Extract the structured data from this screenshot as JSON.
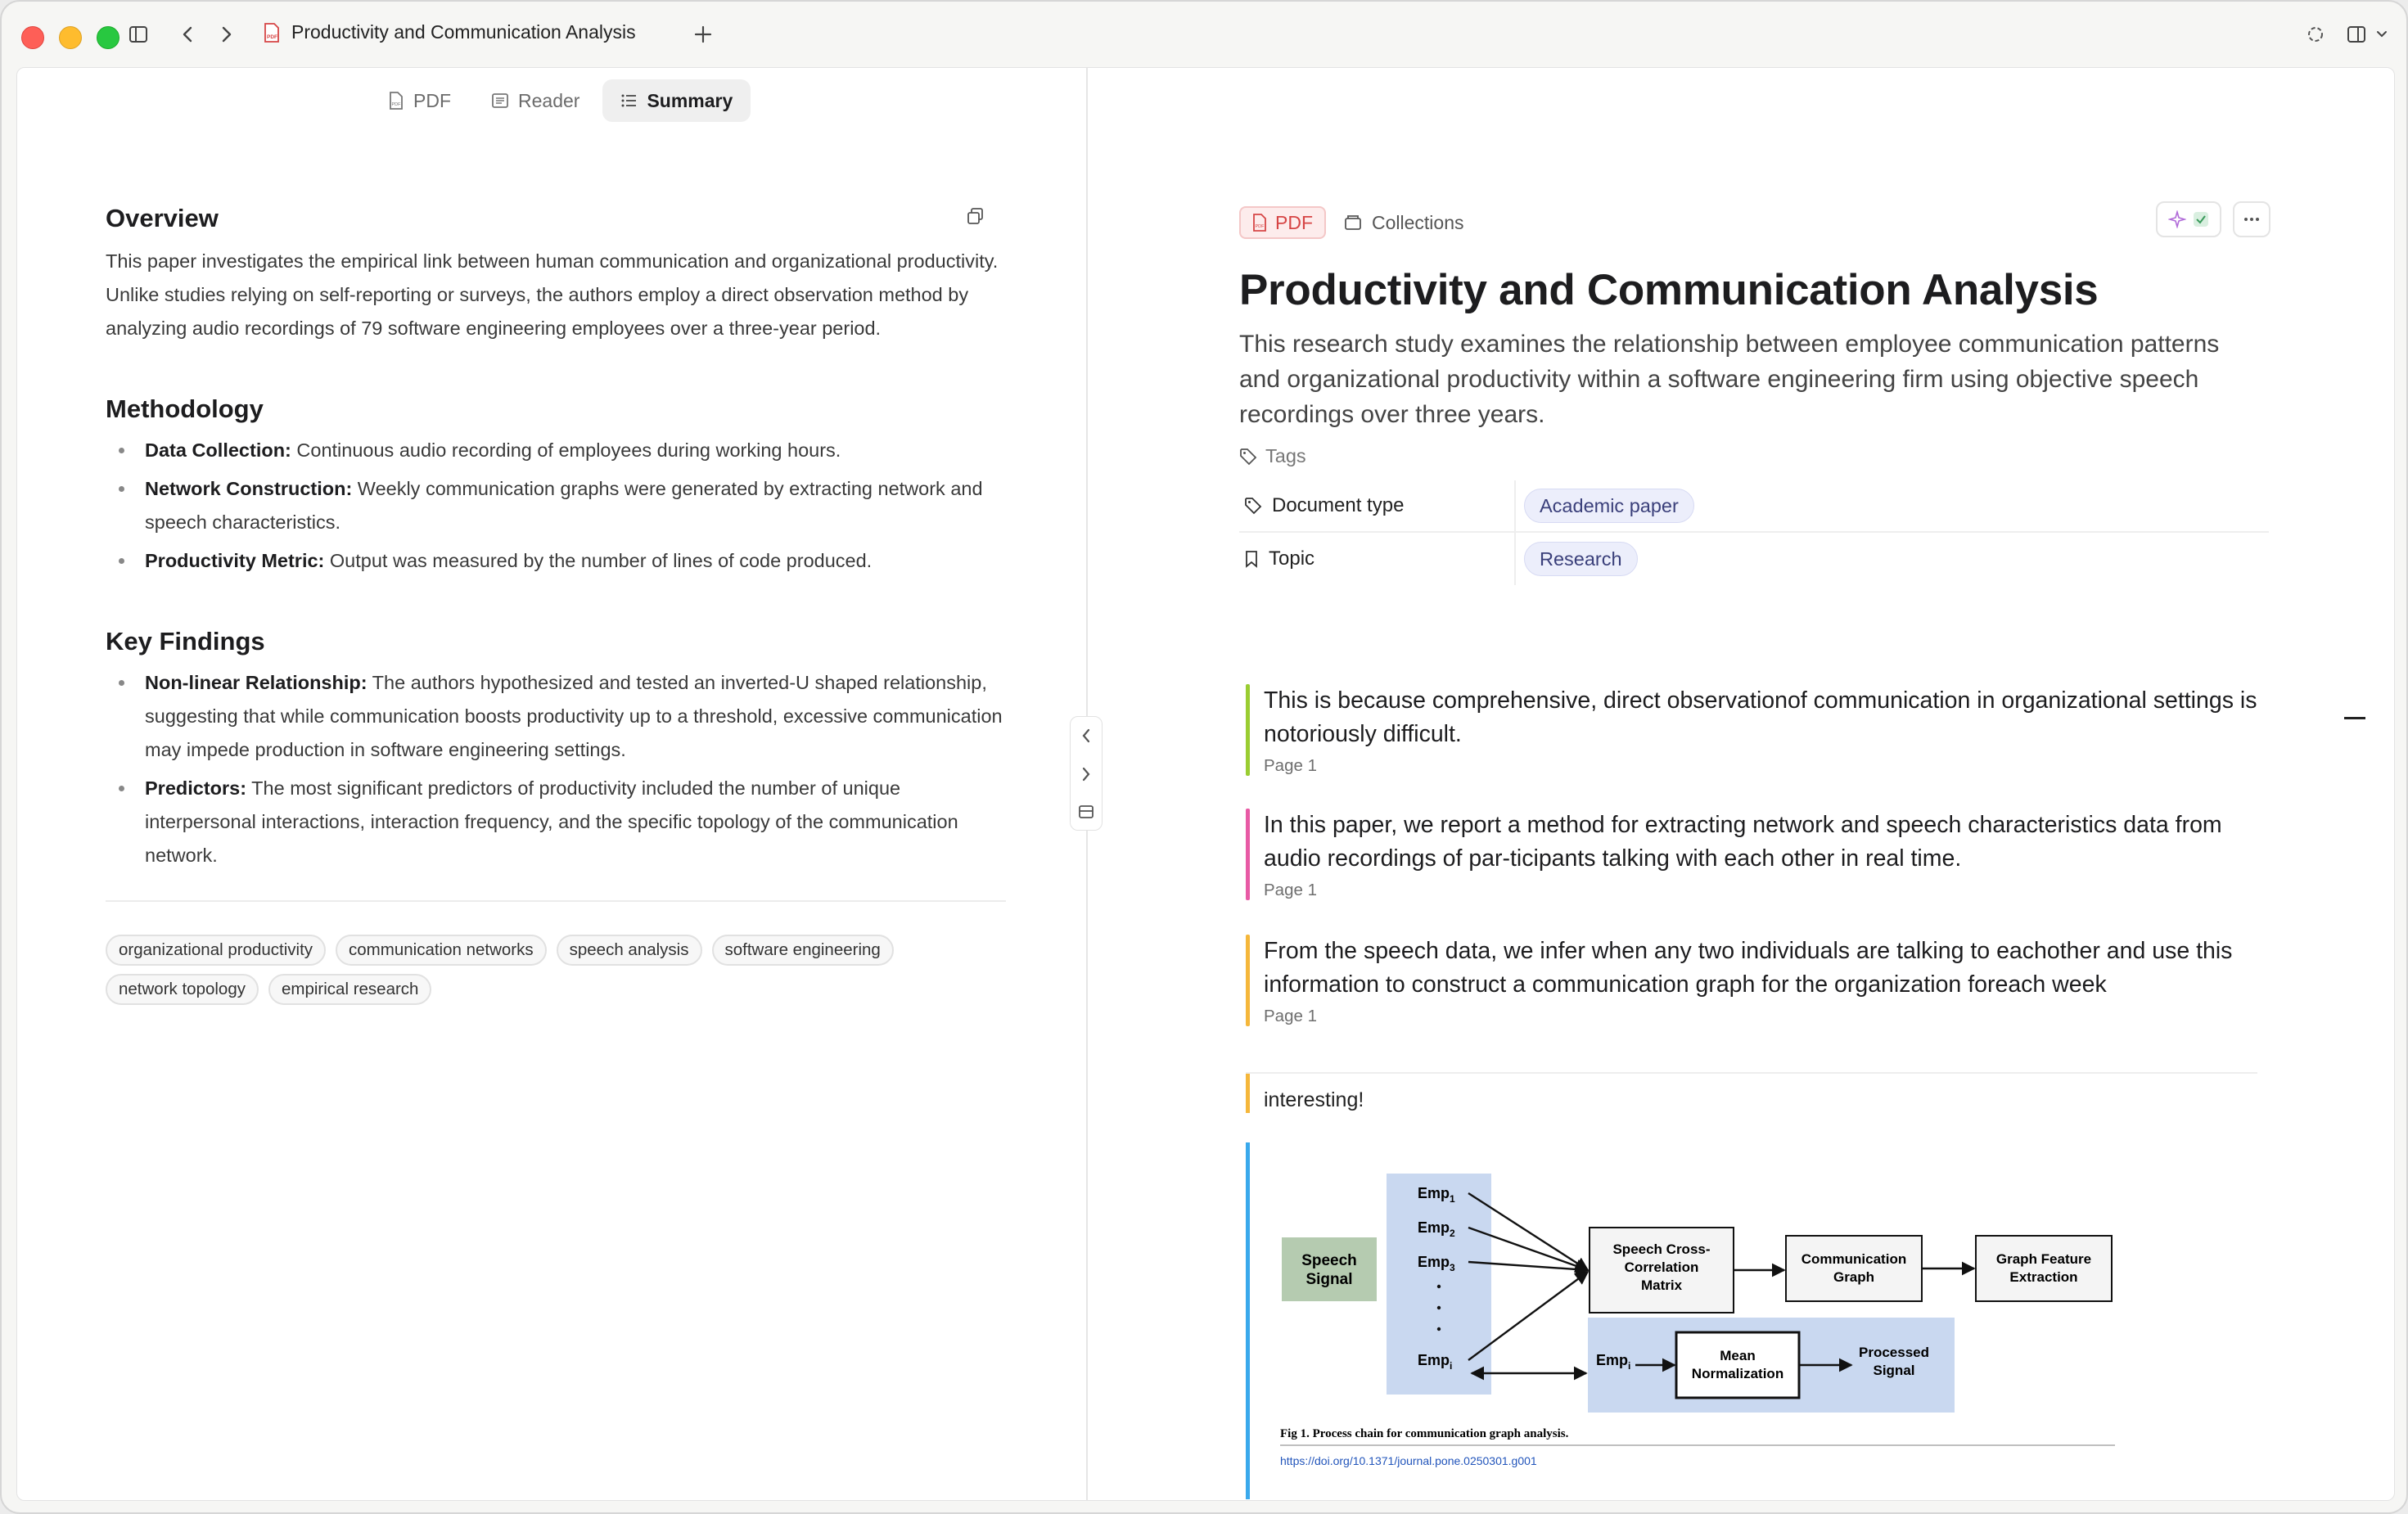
{
  "window": {
    "tab_title": "Productivity and Communication Analysis"
  },
  "segmented": {
    "tabs": [
      {
        "label": "PDF"
      },
      {
        "label": "Reader"
      },
      {
        "label": "Summary"
      }
    ],
    "active": "Summary"
  },
  "summary": {
    "overview_heading": "Overview",
    "overview_text": "This paper investigates the empirical link between human communication and organizational productivity. Unlike studies relying on self-reporting or surveys, the authors employ a direct observation method by analyzing audio recordings of 79 software engineering employees over a three-year period.",
    "methodology_heading": "Methodology",
    "methodology": [
      {
        "term": "Data Collection:",
        "text": " Continuous audio recording of employees during working hours."
      },
      {
        "term": "Network Construction:",
        "text": " Weekly communication graphs were generated by extracting network and speech characteristics."
      },
      {
        "term": "Productivity Metric:",
        "text": " Output was measured by the number of lines of code produced."
      }
    ],
    "findings_heading": "Key Findings",
    "findings": [
      {
        "term": "Non-linear Relationship:",
        "text": " The authors hypothesized and tested an inverted-U shaped relationship, suggesting that while communication boosts productivity up to a threshold, excessive communication may impede production in software engineering settings."
      },
      {
        "term": "Predictors:",
        "text": " The most significant predictors of productivity included the number of unique interpersonal interactions, interaction frequency, and the specific topology of the communication network."
      }
    ],
    "keywords": [
      "organizational productivity",
      "communication networks",
      "speech analysis",
      "software engineering",
      "network topology",
      "empirical research"
    ]
  },
  "document": {
    "pdf_badge": "PDF",
    "collections_label": "Collections",
    "title": "Productivity and Communication Analysis",
    "description": "This research study examines the relationship between employee communication patterns and organizational productivity within a software engineering firm using objective speech recordings over three years.",
    "tags_label": "Tags",
    "properties": [
      {
        "key": "Document type",
        "value": "Academic paper"
      },
      {
        "key": "Topic",
        "value": "Research"
      }
    ]
  },
  "highlights": [
    {
      "text": "This is because comprehensive, direct observationof communication in organizational settings is notoriously difficult.",
      "page": "Page 1",
      "color": "#9acd32"
    },
    {
      "text": "In this paper, we report a method for extracting network and speech characteristics data from audio recordings of par-ticipants talking with each other in real time.",
      "page": "Page 1",
      "color": "#e85aa5"
    },
    {
      "text": "From the speech data, we infer when any two individuals are talking to eachother and use this information to construct a communication graph for the organization foreach week",
      "page": "Page 1",
      "color": "#f5b73b"
    }
  ],
  "note": {
    "text": "interesting!"
  },
  "figure": {
    "speech_signal": [
      "Speech",
      "Signal"
    ],
    "employees": [
      "Emp",
      "Emp",
      "Emp",
      "Emp"
    ],
    "emp_subs": [
      "1",
      "2",
      "3",
      "i"
    ],
    "cross_corr": [
      "Speech Cross-",
      "Correlation",
      "Matrix"
    ],
    "comm_graph": [
      "Communication",
      "Graph"
    ],
    "graph_feat": [
      "Graph Feature",
      "Extraction"
    ],
    "mean_norm": [
      "Mean",
      "Normalization"
    ],
    "processed": [
      "Processed",
      "Signal"
    ],
    "emp_i": "Emp",
    "caption": "Fig 1.  Process chain for communication graph analysis.",
    "doi": "https://doi.org/10.1371/journal.pone.0250301.g001"
  }
}
